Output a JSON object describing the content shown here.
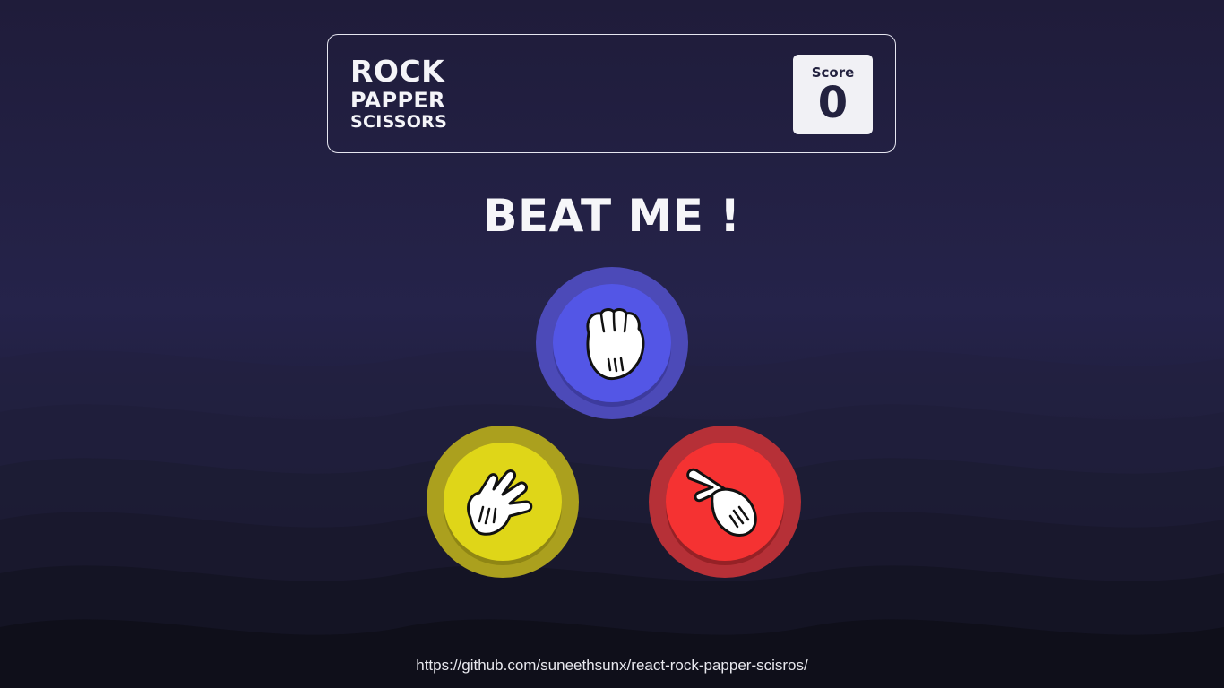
{
  "logo": {
    "line1": "ROCK",
    "line2": "PAPPER",
    "line3": "SCISSORS"
  },
  "score": {
    "label": "Score",
    "value": "0"
  },
  "headline": "BEAT ME !",
  "choices": [
    {
      "id": "rock",
      "icon": "rock-hand-icon",
      "color": "#5356e6",
      "ring": "#4c4ab8"
    },
    {
      "id": "paper",
      "icon": "paper-hand-icon",
      "color": "#dfd618",
      "ring": "#aba01e"
    },
    {
      "id": "scissors",
      "icon": "scissors-hand-icon",
      "color": "#f53232",
      "ring": "#b63037"
    }
  ],
  "footer": {
    "link_text": "https://github.com/suneethsunx/react-rock-papper-scisros/"
  }
}
